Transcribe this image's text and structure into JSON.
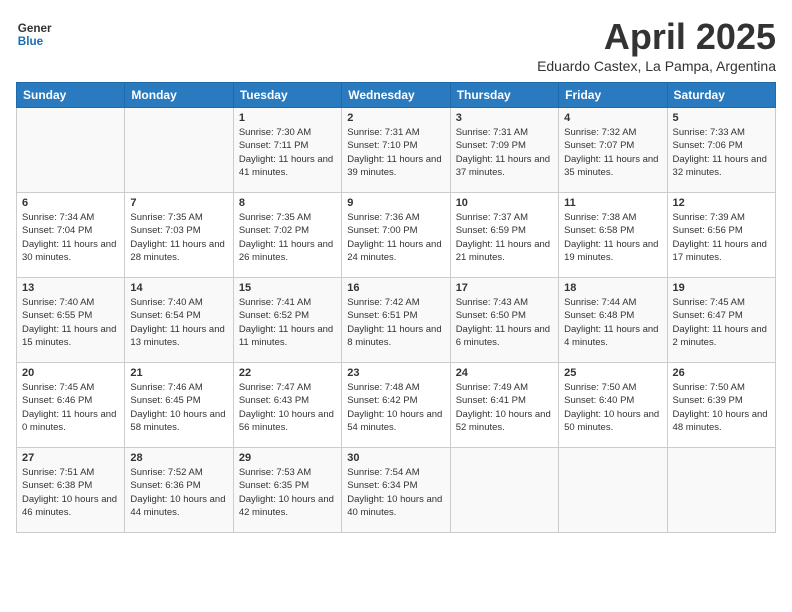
{
  "header": {
    "logo_line1": "General",
    "logo_line2": "Blue",
    "month_title": "April 2025",
    "subtitle": "Eduardo Castex, La Pampa, Argentina"
  },
  "weekdays": [
    "Sunday",
    "Monday",
    "Tuesday",
    "Wednesday",
    "Thursday",
    "Friday",
    "Saturday"
  ],
  "weeks": [
    [
      {
        "day": "",
        "info": ""
      },
      {
        "day": "",
        "info": ""
      },
      {
        "day": "1",
        "info": "Sunrise: 7:30 AM\nSunset: 7:11 PM\nDaylight: 11 hours and 41 minutes."
      },
      {
        "day": "2",
        "info": "Sunrise: 7:31 AM\nSunset: 7:10 PM\nDaylight: 11 hours and 39 minutes."
      },
      {
        "day": "3",
        "info": "Sunrise: 7:31 AM\nSunset: 7:09 PM\nDaylight: 11 hours and 37 minutes."
      },
      {
        "day": "4",
        "info": "Sunrise: 7:32 AM\nSunset: 7:07 PM\nDaylight: 11 hours and 35 minutes."
      },
      {
        "day": "5",
        "info": "Sunrise: 7:33 AM\nSunset: 7:06 PM\nDaylight: 11 hours and 32 minutes."
      }
    ],
    [
      {
        "day": "6",
        "info": "Sunrise: 7:34 AM\nSunset: 7:04 PM\nDaylight: 11 hours and 30 minutes."
      },
      {
        "day": "7",
        "info": "Sunrise: 7:35 AM\nSunset: 7:03 PM\nDaylight: 11 hours and 28 minutes."
      },
      {
        "day": "8",
        "info": "Sunrise: 7:35 AM\nSunset: 7:02 PM\nDaylight: 11 hours and 26 minutes."
      },
      {
        "day": "9",
        "info": "Sunrise: 7:36 AM\nSunset: 7:00 PM\nDaylight: 11 hours and 24 minutes."
      },
      {
        "day": "10",
        "info": "Sunrise: 7:37 AM\nSunset: 6:59 PM\nDaylight: 11 hours and 21 minutes."
      },
      {
        "day": "11",
        "info": "Sunrise: 7:38 AM\nSunset: 6:58 PM\nDaylight: 11 hours and 19 minutes."
      },
      {
        "day": "12",
        "info": "Sunrise: 7:39 AM\nSunset: 6:56 PM\nDaylight: 11 hours and 17 minutes."
      }
    ],
    [
      {
        "day": "13",
        "info": "Sunrise: 7:40 AM\nSunset: 6:55 PM\nDaylight: 11 hours and 15 minutes."
      },
      {
        "day": "14",
        "info": "Sunrise: 7:40 AM\nSunset: 6:54 PM\nDaylight: 11 hours and 13 minutes."
      },
      {
        "day": "15",
        "info": "Sunrise: 7:41 AM\nSunset: 6:52 PM\nDaylight: 11 hours and 11 minutes."
      },
      {
        "day": "16",
        "info": "Sunrise: 7:42 AM\nSunset: 6:51 PM\nDaylight: 11 hours and 8 minutes."
      },
      {
        "day": "17",
        "info": "Sunrise: 7:43 AM\nSunset: 6:50 PM\nDaylight: 11 hours and 6 minutes."
      },
      {
        "day": "18",
        "info": "Sunrise: 7:44 AM\nSunset: 6:48 PM\nDaylight: 11 hours and 4 minutes."
      },
      {
        "day": "19",
        "info": "Sunrise: 7:45 AM\nSunset: 6:47 PM\nDaylight: 11 hours and 2 minutes."
      }
    ],
    [
      {
        "day": "20",
        "info": "Sunrise: 7:45 AM\nSunset: 6:46 PM\nDaylight: 11 hours and 0 minutes."
      },
      {
        "day": "21",
        "info": "Sunrise: 7:46 AM\nSunset: 6:45 PM\nDaylight: 10 hours and 58 minutes."
      },
      {
        "day": "22",
        "info": "Sunrise: 7:47 AM\nSunset: 6:43 PM\nDaylight: 10 hours and 56 minutes."
      },
      {
        "day": "23",
        "info": "Sunrise: 7:48 AM\nSunset: 6:42 PM\nDaylight: 10 hours and 54 minutes."
      },
      {
        "day": "24",
        "info": "Sunrise: 7:49 AM\nSunset: 6:41 PM\nDaylight: 10 hours and 52 minutes."
      },
      {
        "day": "25",
        "info": "Sunrise: 7:50 AM\nSunset: 6:40 PM\nDaylight: 10 hours and 50 minutes."
      },
      {
        "day": "26",
        "info": "Sunrise: 7:50 AM\nSunset: 6:39 PM\nDaylight: 10 hours and 48 minutes."
      }
    ],
    [
      {
        "day": "27",
        "info": "Sunrise: 7:51 AM\nSunset: 6:38 PM\nDaylight: 10 hours and 46 minutes."
      },
      {
        "day": "28",
        "info": "Sunrise: 7:52 AM\nSunset: 6:36 PM\nDaylight: 10 hours and 44 minutes."
      },
      {
        "day": "29",
        "info": "Sunrise: 7:53 AM\nSunset: 6:35 PM\nDaylight: 10 hours and 42 minutes."
      },
      {
        "day": "30",
        "info": "Sunrise: 7:54 AM\nSunset: 6:34 PM\nDaylight: 10 hours and 40 minutes."
      },
      {
        "day": "",
        "info": ""
      },
      {
        "day": "",
        "info": ""
      },
      {
        "day": "",
        "info": ""
      }
    ]
  ]
}
